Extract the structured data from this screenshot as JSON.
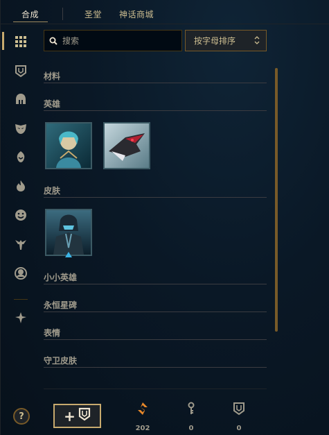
{
  "tabs": [
    {
      "label": "合成",
      "active": true
    },
    {
      "label": "圣堂",
      "active": false
    },
    {
      "label": "神话商城",
      "active": false
    }
  ],
  "sidebar": {
    "icons": [
      "grid-icon",
      "crest-icon",
      "helmet-icon",
      "mask-icon",
      "champion-head-icon",
      "flame-icon",
      "emote-face-icon",
      "ward-icon",
      "avatar-icon",
      "arrows-down-icon"
    ],
    "active_index": 0
  },
  "search": {
    "placeholder": "搜索",
    "value": ""
  },
  "sort": {
    "label": "按字母排序"
  },
  "sections": [
    {
      "title": "材料"
    },
    {
      "title": "英雄"
    },
    {
      "title": "皮肤"
    },
    {
      "title": "小小英雄"
    },
    {
      "title": "永恒星碑"
    },
    {
      "title": "表情"
    },
    {
      "title": "守卫皮肤"
    }
  ],
  "items": {
    "champions": [
      "champion-portrait-1",
      "champion-portrait-2"
    ],
    "skins": [
      "skin-portrait-1"
    ]
  },
  "bottom": {
    "help_label": "?",
    "add_label": "+",
    "currencies": [
      {
        "icon": "orange-essence-icon",
        "value": "202"
      },
      {
        "icon": "key-icon",
        "value": "0"
      },
      {
        "icon": "crest-token-icon",
        "value": "0"
      }
    ]
  },
  "colors": {
    "gold": "#c8aa6e",
    "text": "#a09b8c",
    "bg": "#081320"
  }
}
